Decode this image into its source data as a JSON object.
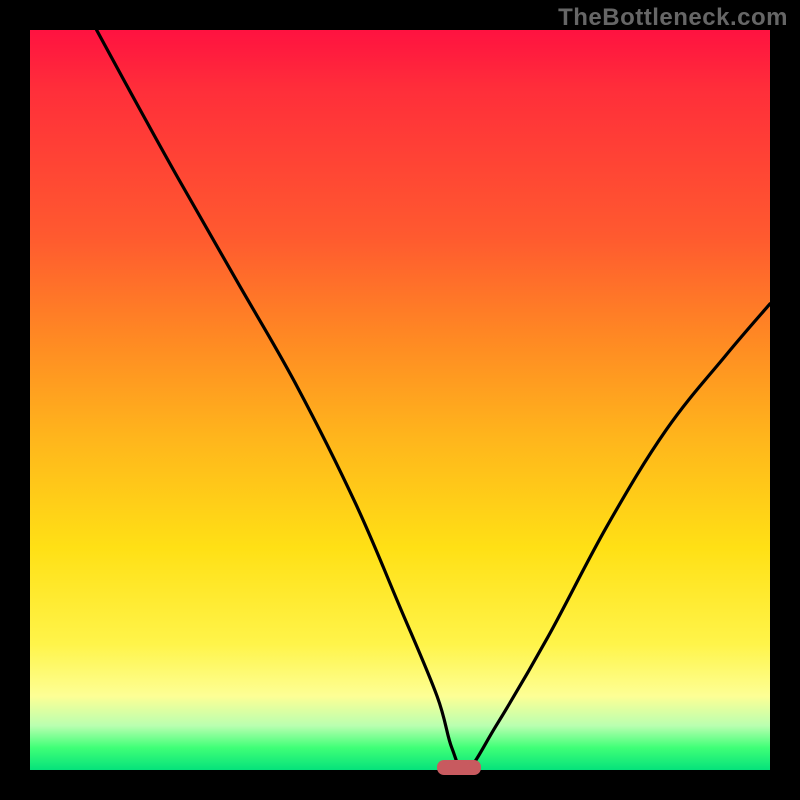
{
  "watermark": "TheBottleneck.com",
  "chart_data": {
    "type": "line",
    "title": "",
    "xlabel": "",
    "ylabel": "",
    "xlim": [
      0,
      100
    ],
    "ylim": [
      0,
      100
    ],
    "series": [
      {
        "name": "curve",
        "x": [
          9,
          15,
          20,
          28,
          36,
          44,
          50,
          55,
          57,
          59,
          63,
          70,
          78,
          86,
          94,
          100
        ],
        "y": [
          100,
          89,
          80,
          66,
          52,
          36,
          22,
          10,
          3,
          0,
          6,
          18,
          33,
          46,
          56,
          63
        ]
      }
    ],
    "marker": {
      "x": 58,
      "y": 0
    },
    "gradient_stops": [
      {
        "pos": 0,
        "color": "#ff1240"
      },
      {
        "pos": 28,
        "color": "#ff5a2f"
      },
      {
        "pos": 55,
        "color": "#ffb51c"
      },
      {
        "pos": 83,
        "color": "#fff44a"
      },
      {
        "pos": 97,
        "color": "#3fff77"
      },
      {
        "pos": 100,
        "color": "#05e27b"
      }
    ]
  }
}
